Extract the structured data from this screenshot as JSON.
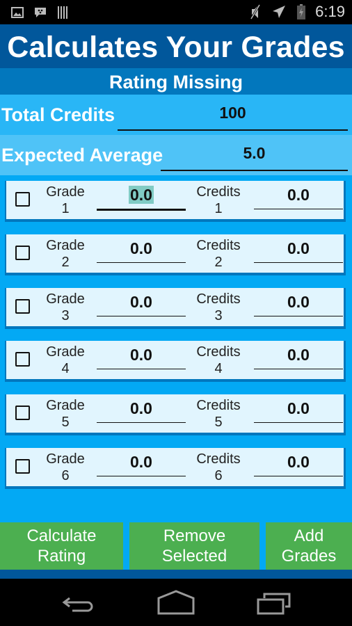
{
  "status_bar": {
    "left_icons": [
      "image-icon",
      "bbm-chat-icon",
      "barcode-icon"
    ],
    "right_icons": [
      "mute-icon",
      "airplane-mode-icon",
      "battery-charging-icon"
    ],
    "time": "6:19"
  },
  "header": {
    "title": "Calculates Your Grades",
    "subtitle": "Rating Missing"
  },
  "summary": {
    "total_credits_label": "Total Credits",
    "total_credits_value": "100",
    "expected_average_label": "Expected Average",
    "expected_average_value": "5.0"
  },
  "grade_rows": [
    {
      "grade_label": "Grade",
      "index": "1",
      "grade_value": "0.0",
      "credits_label": "Credits",
      "credits_value": "0.0",
      "checked": false,
      "focused": true
    },
    {
      "grade_label": "Grade",
      "index": "2",
      "grade_value": "0.0",
      "credits_label": "Credits",
      "credits_value": "0.0",
      "checked": false
    },
    {
      "grade_label": "Grade",
      "index": "3",
      "grade_value": "0.0",
      "credits_label": "Credits",
      "credits_value": "0.0",
      "checked": false
    },
    {
      "grade_label": "Grade",
      "index": "4",
      "grade_value": "0.0",
      "credits_label": "Credits",
      "credits_value": "0.0",
      "checked": false
    },
    {
      "grade_label": "Grade",
      "index": "5",
      "grade_value": "0.0",
      "credits_label": "Credits",
      "credits_value": "0.0",
      "checked": false
    },
    {
      "grade_label": "Grade",
      "index": "6",
      "grade_value": "0.0",
      "credits_label": "Credits",
      "credits_value": "0.0",
      "checked": false
    }
  ],
  "buttons": {
    "calculate_line1": "Calculate",
    "calculate_line2": "Rating",
    "remove_line1": "Remove",
    "remove_line2": "Selected",
    "add_line1": "Add",
    "add_line2": "Grades"
  },
  "nav_bar": {
    "icons": [
      "back-icon",
      "home-icon",
      "recent-apps-icon"
    ]
  },
  "colors": {
    "header_dark": "#01579b",
    "subtitle": "#0277bd",
    "background": "#03a9f4",
    "card": "#e1f5fe",
    "button": "#4caf50",
    "highlight": "#80cbc4"
  }
}
